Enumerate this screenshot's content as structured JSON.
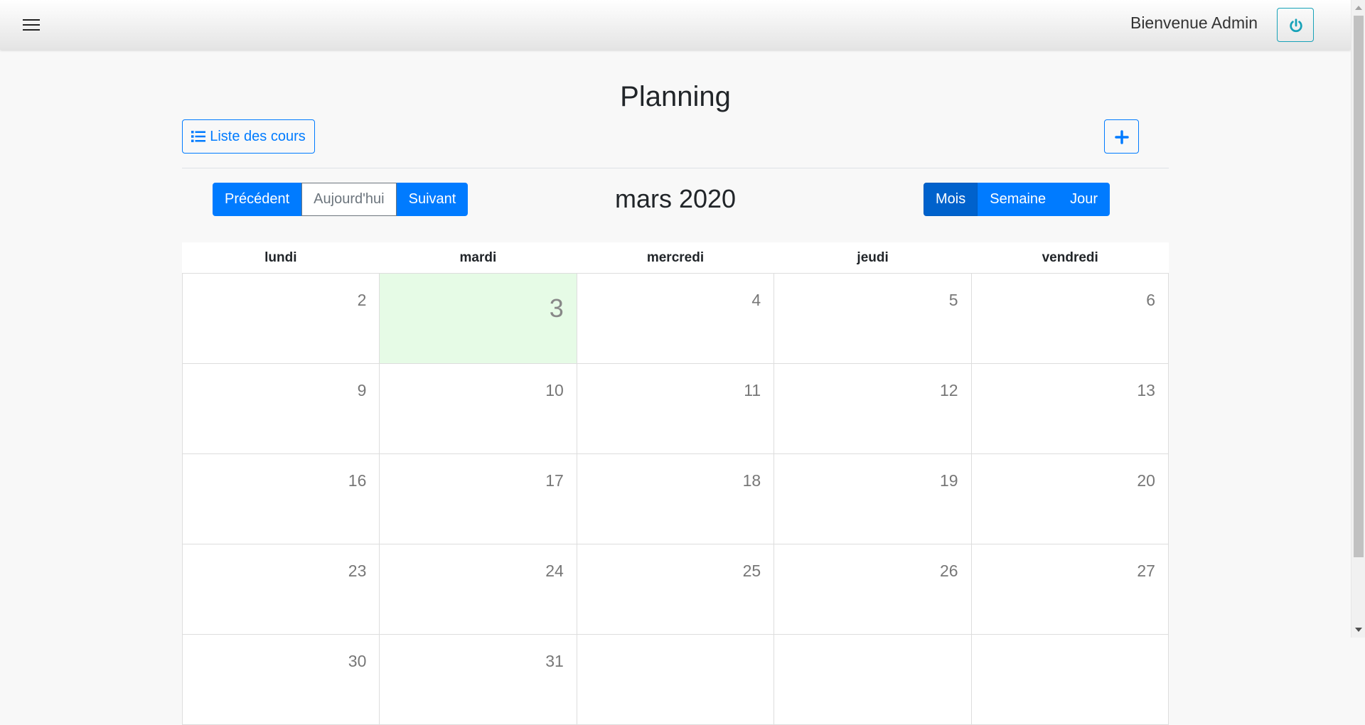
{
  "navbar": {
    "welcome": "Bienvenue Admin",
    "menu_icon": "hamburger-menu-icon",
    "power_icon": "power-icon",
    "power_color": "#17a2b8"
  },
  "page": {
    "title": "Planning",
    "list_button_label": "Liste des cours",
    "list_icon": "list-icon",
    "add_icon": "plus-icon"
  },
  "toolbar": {
    "prev": "Précédent",
    "today": "Aujourd'hui",
    "next": "Suivant",
    "month_title": "mars 2020",
    "views": [
      "Mois",
      "Semaine",
      "Jour"
    ],
    "active_view": "Mois"
  },
  "calendar": {
    "weekdays": [
      "lundi",
      "mardi",
      "mercredi",
      "jeudi",
      "vendredi"
    ],
    "weeks": [
      [
        "2",
        "3",
        "4",
        "5",
        "6"
      ],
      [
        "9",
        "10",
        "11",
        "12",
        "13"
      ],
      [
        "16",
        "17",
        "18",
        "19",
        "20"
      ],
      [
        "23",
        "24",
        "25",
        "26",
        "27"
      ],
      [
        "30",
        "31",
        "",
        "",
        ""
      ]
    ],
    "today": "3"
  },
  "colors": {
    "primary": "#007bff",
    "active": "#0062cc",
    "today_bg": "#e6fbe6"
  }
}
